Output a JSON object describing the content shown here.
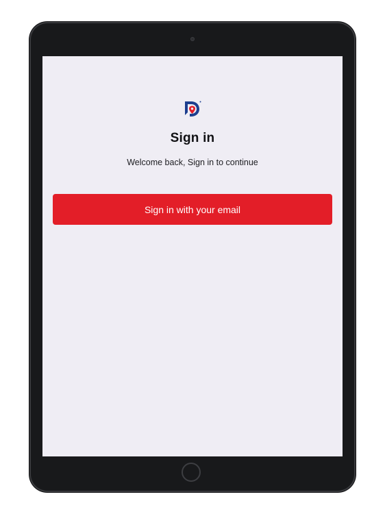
{
  "app": {
    "brand_color": "#e31e28",
    "logo_colors": {
      "blue": "#1d3f8f",
      "red": "#e31e28"
    },
    "logo_icon": "brand-logo-icon"
  },
  "signin": {
    "title": "Sign in",
    "subtitle": "Welcome back, Sign in to continue",
    "email_button_label": "Sign in with your email"
  }
}
